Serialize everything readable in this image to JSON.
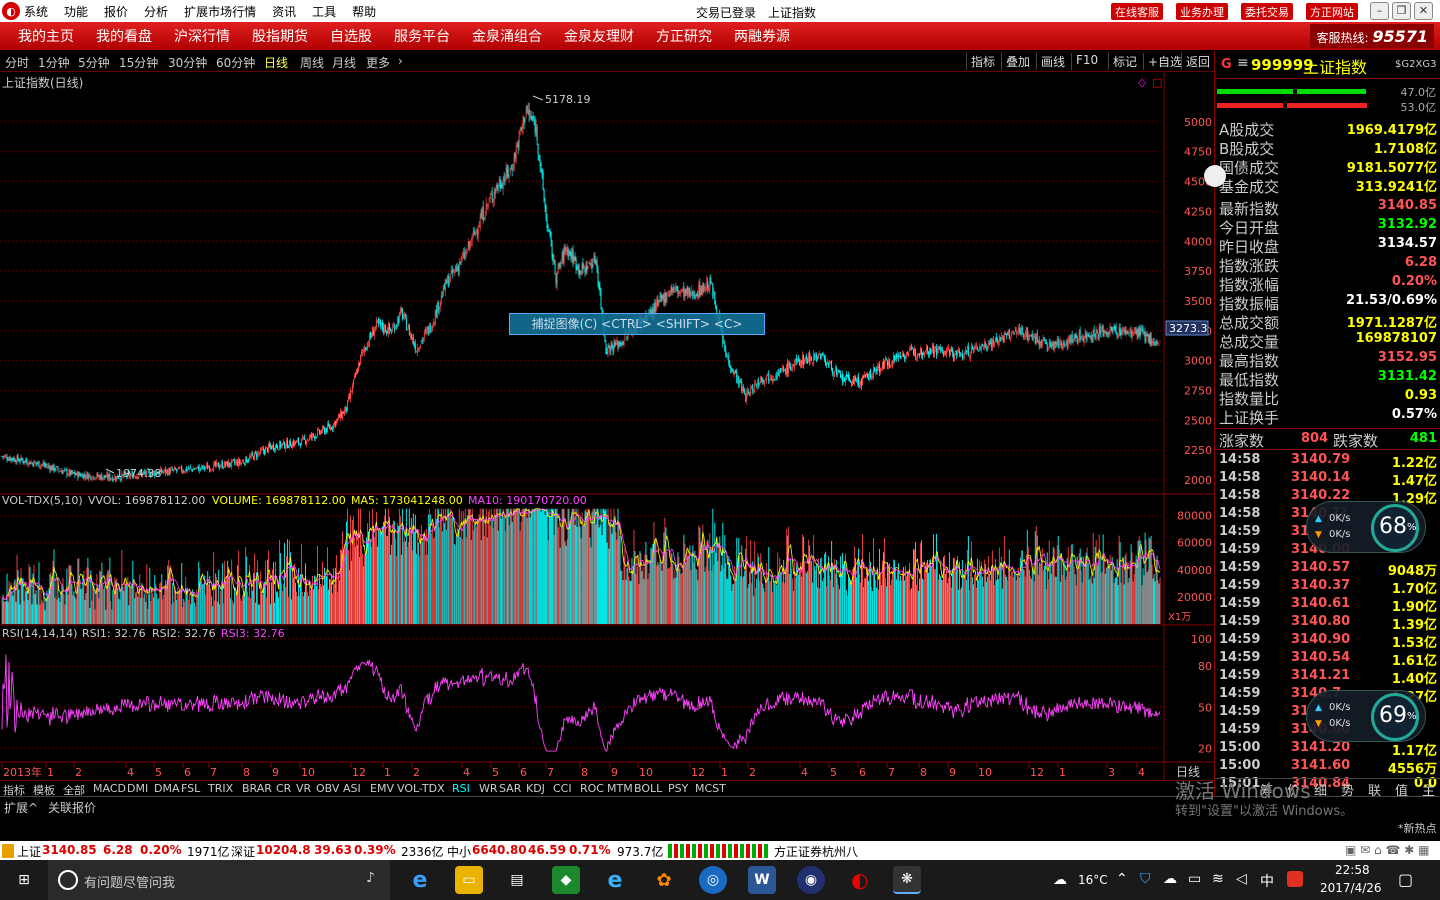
{
  "menubar": {
    "items": [
      "系统",
      "功能",
      "报价",
      "分析",
      "扩展市场行情",
      "资讯",
      "工具",
      "帮助"
    ],
    "status": "交易已登录",
    "title": "上证指数",
    "buttons": [
      "在线客服",
      "业务办理",
      "委托交易",
      "方正网站"
    ]
  },
  "navbar": {
    "items": [
      "我的主页",
      "我的看盘",
      "沪深行情",
      "股指期货",
      "自选股",
      "服务平台",
      "金泉涌组合",
      "金泉友理财",
      "方正研究",
      "两融券源"
    ],
    "hotline_label": "客服热线:",
    "hotline": "95571"
  },
  "periods": {
    "items": [
      "分时",
      "1分钟",
      "5分钟",
      "15分钟",
      "30分钟",
      "60分钟",
      "日线",
      "周线",
      "月线",
      "更多"
    ],
    "selected": "日线",
    "tools": [
      "指标",
      "叠加",
      "画线",
      "F10",
      "标记",
      "+自选",
      "返回"
    ]
  },
  "chart_data": {
    "type": "candlestick",
    "title": "上证指数(日线)",
    "price_axis": {
      "ticks": [
        5000,
        4750,
        4500,
        4250,
        4000,
        3750,
        3500,
        3250,
        3000,
        2750,
        2500,
        2250,
        2000
      ],
      "range": [
        1900,
        5250
      ]
    },
    "high_label": "5178.19",
    "low_label": "1974.38",
    "current_price_tag": "3273.3",
    "close_series_keypoints": [
      {
        "i": 0,
        "v": 2200
      },
      {
        "i": 40,
        "v": 2130
      },
      {
        "i": 70,
        "v": 2050
      },
      {
        "i": 110,
        "v": 2020
      },
      {
        "i": 150,
        "v": 2060
      },
      {
        "i": 200,
        "v": 2100
      },
      {
        "i": 240,
        "v": 2150
      },
      {
        "i": 270,
        "v": 2280
      },
      {
        "i": 300,
        "v": 2320
      },
      {
        "i": 330,
        "v": 2450
      },
      {
        "i": 345,
        "v": 2600
      },
      {
        "i": 360,
        "v": 3050
      },
      {
        "i": 375,
        "v": 3300
      },
      {
        "i": 390,
        "v": 3250
      },
      {
        "i": 400,
        "v": 3400
      },
      {
        "i": 415,
        "v": 3100
      },
      {
        "i": 430,
        "v": 3300
      },
      {
        "i": 445,
        "v": 3650
      },
      {
        "i": 465,
        "v": 3900
      },
      {
        "i": 480,
        "v": 4200
      },
      {
        "i": 495,
        "v": 4450
      },
      {
        "i": 510,
        "v": 4600
      },
      {
        "i": 525,
        "v": 5100
      },
      {
        "i": 535,
        "v": 4950
      },
      {
        "i": 545,
        "v": 4200
      },
      {
        "i": 555,
        "v": 3700
      },
      {
        "i": 565,
        "v": 3950
      },
      {
        "i": 580,
        "v": 3750
      },
      {
        "i": 595,
        "v": 3850
      },
      {
        "i": 605,
        "v": 3100
      },
      {
        "i": 620,
        "v": 3150
      },
      {
        "i": 635,
        "v": 3300
      },
      {
        "i": 650,
        "v": 3400
      },
      {
        "i": 670,
        "v": 3600
      },
      {
        "i": 690,
        "v": 3550
      },
      {
        "i": 710,
        "v": 3650
      },
      {
        "i": 725,
        "v": 3050
      },
      {
        "i": 745,
        "v": 2700
      },
      {
        "i": 760,
        "v": 2850
      },
      {
        "i": 780,
        "v": 2900
      },
      {
        "i": 800,
        "v": 3000
      },
      {
        "i": 820,
        "v": 3050
      },
      {
        "i": 840,
        "v": 2850
      },
      {
        "i": 860,
        "v": 2820
      },
      {
        "i": 880,
        "v": 2950
      },
      {
        "i": 900,
        "v": 3050
      },
      {
        "i": 930,
        "v": 3100
      },
      {
        "i": 960,
        "v": 3050
      },
      {
        "i": 990,
        "v": 3150
      },
      {
        "i": 1020,
        "v": 3250
      },
      {
        "i": 1050,
        "v": 3120
      },
      {
        "i": 1080,
        "v": 3200
      },
      {
        "i": 1110,
        "v": 3250
      },
      {
        "i": 1140,
        "v": 3230
      },
      {
        "i": 1160,
        "v": 3130
      }
    ],
    "volume_indicator": {
      "label": "VOL-TDX(5,10)",
      "vvol": "VVOL: 169878112.00",
      "volume": "VOLUME: 169878112.00",
      "ma5": "MA5: 173041248.00",
      "ma10": "MA10: 190170720.00",
      "ticks": [
        80000,
        60000,
        40000,
        20000
      ],
      "range": [
        0,
        90000
      ],
      "unit": "X1万"
    },
    "rsi_indicator": {
      "label": "RSI(14,14,14)",
      "rsi1": "RSI1: 32.76",
      "rsi2": "RSI2: 32.76",
      "rsi3": "RSI3: 32.76",
      "ticks": [
        100.0,
        80.0,
        50.0,
        20.0
      ],
      "range": [
        10,
        105
      ]
    },
    "time_axis": {
      "labels": [
        "2013年",
        "1",
        "2",
        "4",
        "5",
        "6",
        "7",
        "8",
        "9",
        "10",
        "12",
        "1",
        "2",
        "4",
        "5",
        "6",
        "7",
        "8",
        "9",
        "10",
        "12",
        "1",
        "2",
        "4",
        "5",
        "6",
        "7",
        "8",
        "9",
        "10",
        "12",
        "1",
        "3",
        "4"
      ],
      "period_label": "日线"
    }
  },
  "tabs": {
    "items": [
      "指标",
      "模板",
      "全部",
      "MACD",
      "DMI",
      "DMA",
      "FSL",
      "TRIX",
      "BRAR",
      "CR",
      "VR",
      "OBV",
      "ASI",
      "EMV",
      "VOL-TDX",
      "RSI",
      "WR",
      "SAR",
      "KDJ",
      "CCI",
      "ROC",
      "MTM",
      "BOLL",
      "PSY",
      "MCST"
    ],
    "selected": "RSI"
  },
  "subtabs": [
    "扩展^",
    "关联报价"
  ],
  "capture_tip": "捕捉图像(C)  <CTRL> <SHIFT> <C>",
  "right": {
    "code": "999999",
    "name": "上证指数",
    "tag": "$G2XG3",
    "icon_g": "G",
    "bar_top_pct": "47.0亿",
    "bar_bot_pct": "53.0亿",
    "turnover": [
      {
        "k": "A股成交",
        "v": "1969.4179亿"
      },
      {
        "k": "B股成交",
        "v": "1.7108亿"
      },
      {
        "k": "国债成交",
        "v": "9181.5077亿"
      },
      {
        "k": "基金成交",
        "v": "313.9241亿"
      }
    ],
    "stats": [
      {
        "k": "最新指数",
        "v": "3140.85",
        "c": "#ff5555"
      },
      {
        "k": "今日开盘",
        "v": "3132.92",
        "c": "#00ff00"
      },
      {
        "k": "昨日收盘",
        "v": "3134.57",
        "c": "#ffffff"
      },
      {
        "k": "指数涨跌",
        "v": "6.28",
        "c": "#ff5555"
      },
      {
        "k": "指数涨幅",
        "v": "0.20%",
        "c": "#ff5555"
      },
      {
        "k": "指数振幅",
        "v": "21.53/0.69%",
        "c": "#ffffff"
      },
      {
        "k": "总成交额",
        "v": "1971.1287亿",
        "c": "#ffff00"
      },
      {
        "k": "总成交量",
        "v": "169878107",
        "c": "#ffff00"
      },
      {
        "k": "最高指数",
        "v": "3152.95",
        "c": "#ff5555"
      },
      {
        "k": "最低指数",
        "v": "3131.42",
        "c": "#00ff00"
      },
      {
        "k": "指数量比",
        "v": "0.93",
        "c": "#ffff00"
      },
      {
        "k": "上证换手",
        "v": "0.57%",
        "c": "#ffffff"
      }
    ],
    "up_label": "涨家数",
    "up": "804",
    "down_label": "跌家数",
    "down": "481",
    "ticks": [
      {
        "t": "14:58",
        "p": "3140.79",
        "v": "1.22亿"
      },
      {
        "t": "14:58",
        "p": "3140.14",
        "v": "1.47亿"
      },
      {
        "t": "14:58",
        "p": "3140.22",
        "v": "1.29亿"
      },
      {
        "t": "14:58",
        "p": "3140.??",
        "v": ""
      },
      {
        "t": "14:59",
        "p": "31",
        "v": ""
      },
      {
        "t": "14:59",
        "p": "3140.00",
        "v": ""
      },
      {
        "t": "14:59",
        "p": "3140.57",
        "v": "9048万"
      },
      {
        "t": "14:59",
        "p": "3140.37",
        "v": "1.70亿"
      },
      {
        "t": "14:59",
        "p": "3140.61",
        "v": "1.90亿"
      },
      {
        "t": "14:59",
        "p": "3140.80",
        "v": "1.39亿"
      },
      {
        "t": "14:59",
        "p": "3140.90",
        "v": "1.53亿"
      },
      {
        "t": "14:59",
        "p": "3140.54",
        "v": "1.61亿"
      },
      {
        "t": "14:59",
        "p": "3141.21",
        "v": "1.40亿"
      },
      {
        "t": "14:59",
        "p": "3140.7",
        "v": "1.27亿"
      },
      {
        "t": "14:59",
        "p": "31",
        "v": ""
      },
      {
        "t": "14:59",
        "p": "3140.60",
        "v": ""
      },
      {
        "t": "15:00",
        "p": "3141.20",
        "v": "1.17亿"
      },
      {
        "t": "15:00",
        "p": "3141.60",
        "v": "4556万"
      },
      {
        "t": "15:01",
        "p": "3140.84",
        "v": "0.0"
      }
    ],
    "bottom_tabs": [
      "主",
      "值",
      "联",
      "势",
      "细",
      "价",
      "筹"
    ]
  },
  "gauges": [
    {
      "pct": "68",
      "unit": "%",
      "up": "0K/s",
      "down": "0K/s"
    },
    {
      "pct": "69",
      "unit": "%",
      "up": "0K/s",
      "down": "0K/s"
    }
  ],
  "watermark": {
    "line1": "激活 Windows",
    "line2": "转到\"设置\"以激活 Windows。"
  },
  "new_hot": "*新热点",
  "statusbar": {
    "sh_label": "上证",
    "sh_val": "3140.85",
    "sh_chg": "6.28",
    "sh_pct": "0.20%",
    "sh_amt": "1971亿",
    "sz_label": "深证",
    "sz_val": "10204.8",
    "sz_chg": "39.63",
    "sz_pct": "0.39%",
    "sz_amt": "2336亿",
    "zx_label": "中小",
    "zx_val": "6640.80",
    "zx_chg": "46.59",
    "zx_pct": "0.71%",
    "zx_amt": "973.7亿",
    "broker": "方正证券杭州八"
  },
  "taskbar": {
    "search_placeholder": "有问题尽管问我",
    "weather": "16°C",
    "ime": "中",
    "time": "22:58",
    "date": "2017/4/26"
  }
}
